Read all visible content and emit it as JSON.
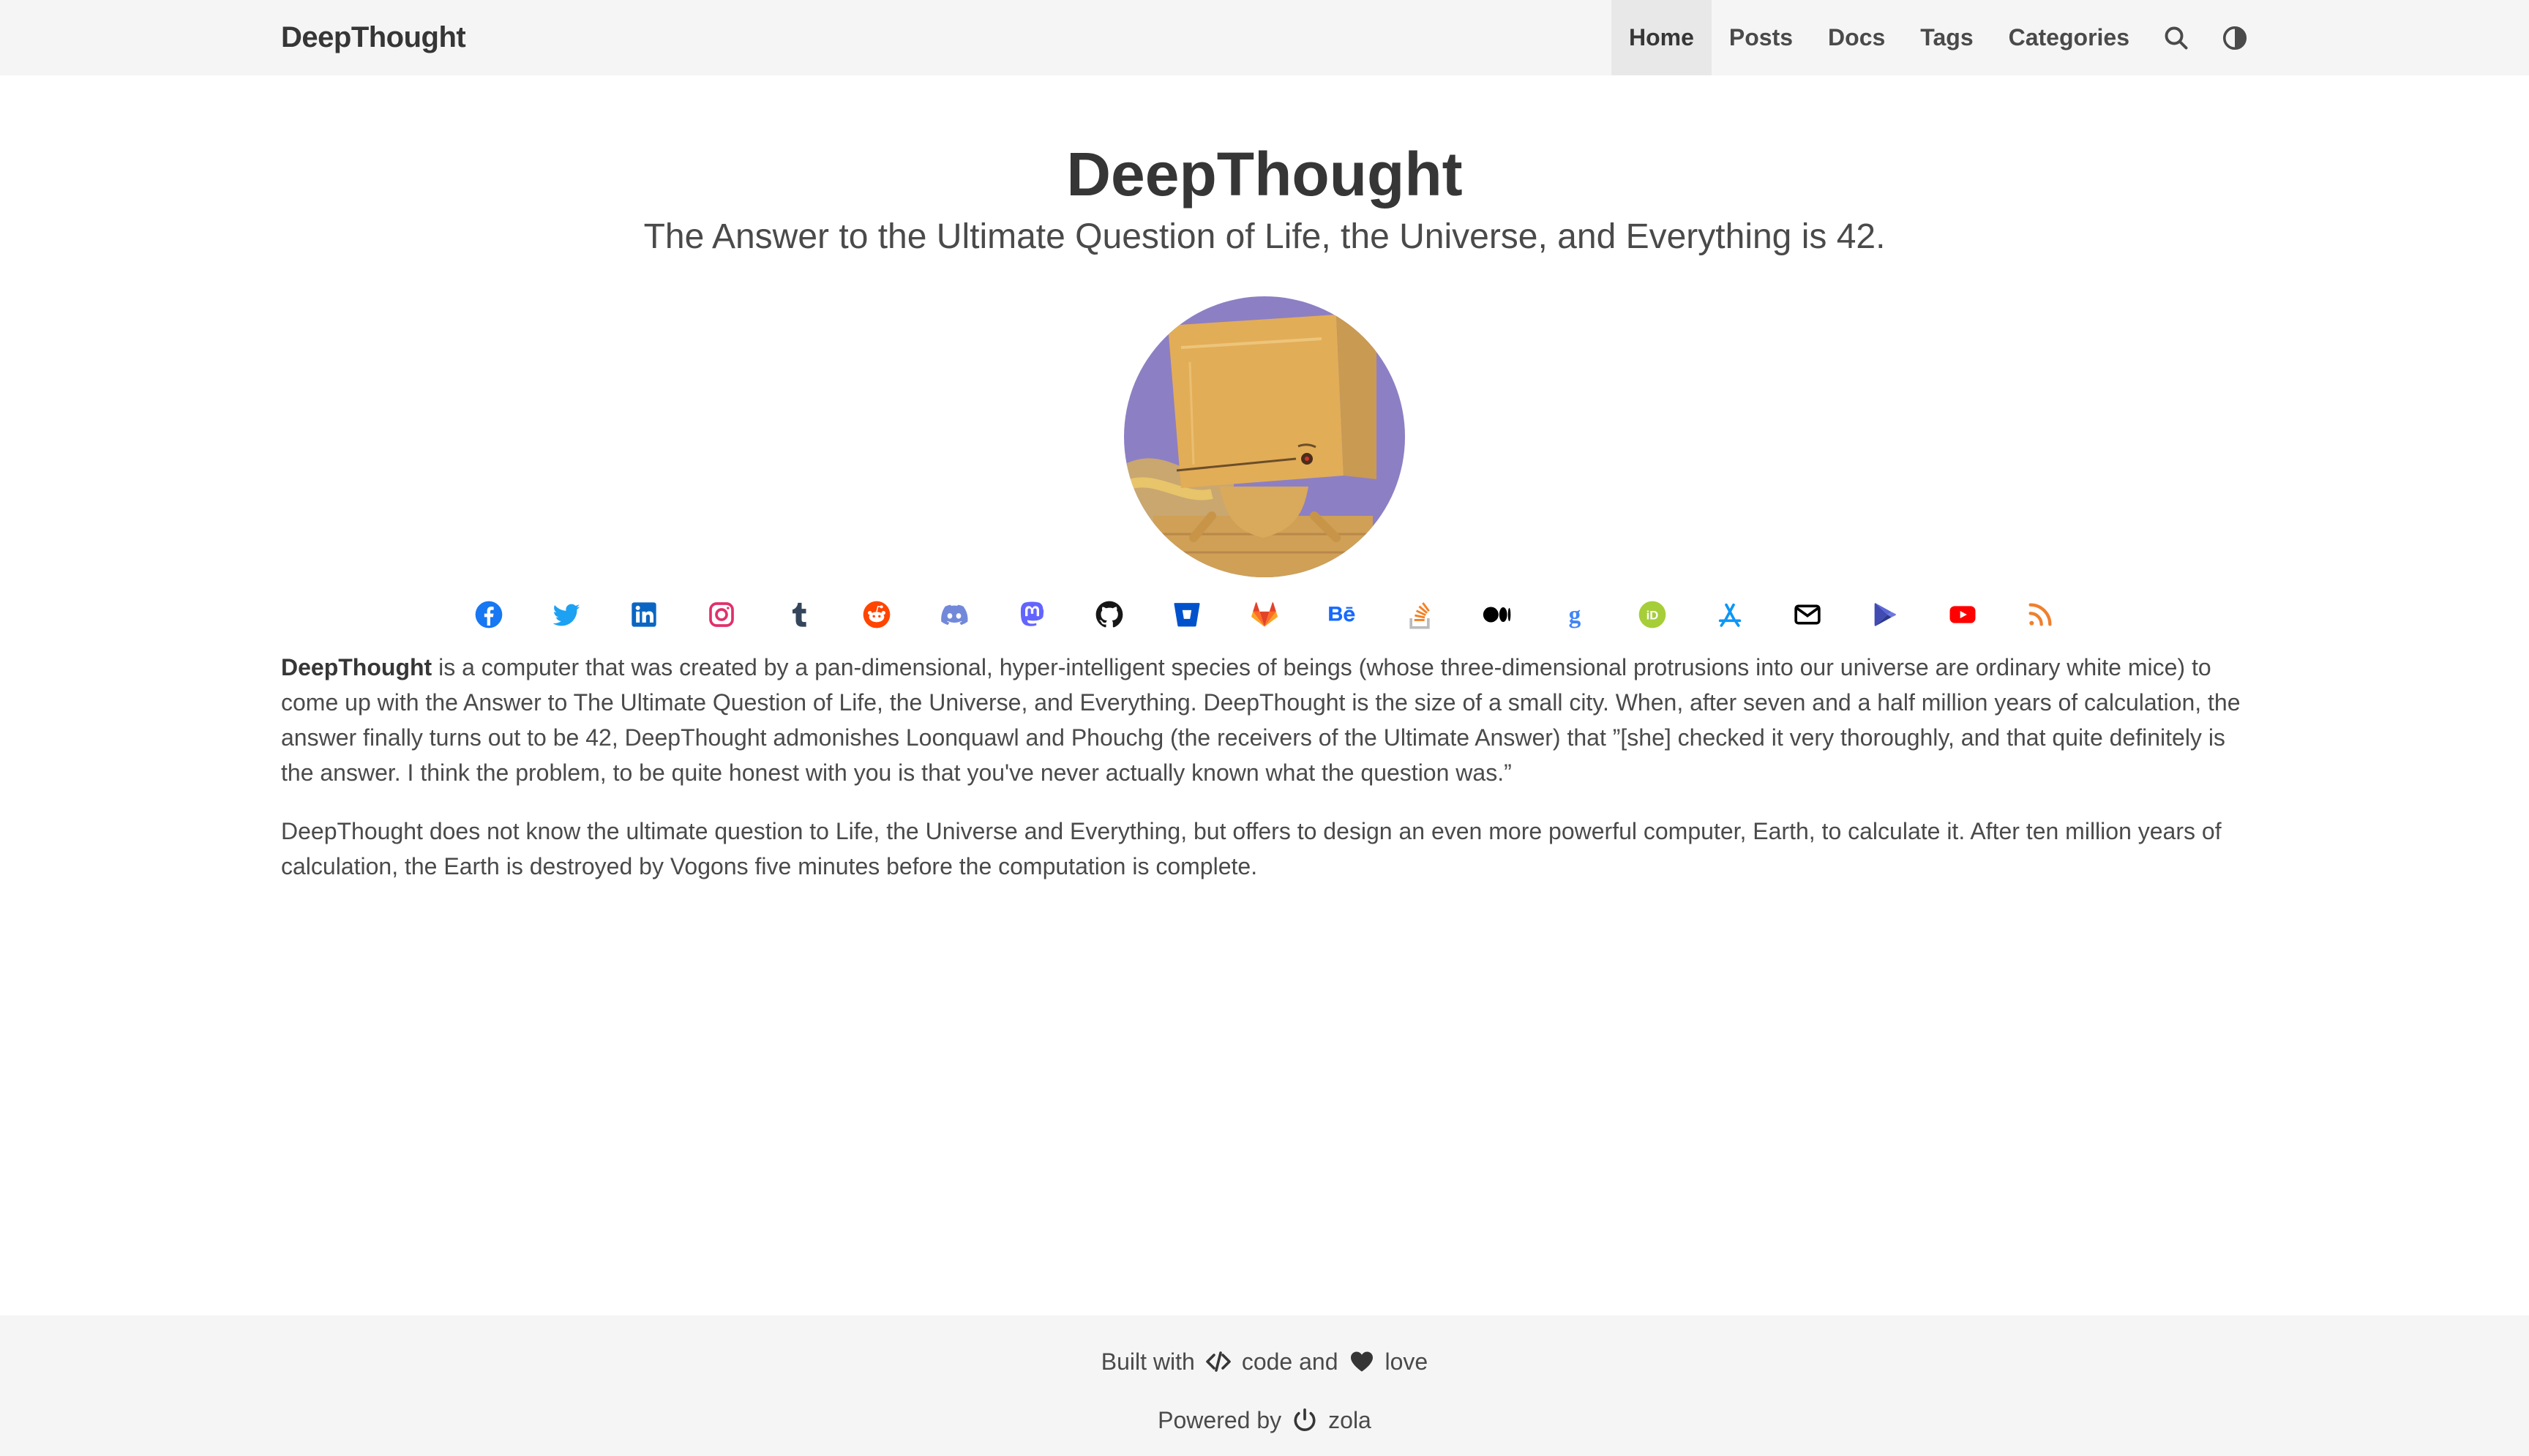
{
  "navbar": {
    "brand": "DeepThought",
    "items": [
      {
        "label": "Home",
        "active": true
      },
      {
        "label": "Posts",
        "active": false
      },
      {
        "label": "Docs",
        "active": false
      },
      {
        "label": "Tags",
        "active": false
      },
      {
        "label": "Categories",
        "active": false
      }
    ],
    "icons": [
      "search-icon",
      "theme-toggle-icon"
    ]
  },
  "hero": {
    "title": "DeepThought",
    "subtitle": "The Answer to the Ultimate Question of Life, the Universe, and Everything is 42."
  },
  "social_icons": [
    {
      "name": "facebook-icon",
      "color": "#1877f2"
    },
    {
      "name": "twitter-icon",
      "color": "#1da1f2"
    },
    {
      "name": "linkedin-icon",
      "color": "#0a66c2"
    },
    {
      "name": "instagram-icon",
      "color": "#e1306c"
    },
    {
      "name": "tumblr-icon",
      "color": "#35465c"
    },
    {
      "name": "reddit-icon",
      "color": "#ff4500"
    },
    {
      "name": "discord-icon",
      "color": "#7289da"
    },
    {
      "name": "mastodon-icon",
      "color": "#6364ff"
    },
    {
      "name": "github-icon",
      "color": "#181717"
    },
    {
      "name": "bitbucket-icon",
      "color": "#0052cc"
    },
    {
      "name": "gitlab-icon",
      "color": "#e24329"
    },
    {
      "name": "behance-icon",
      "color": "#1769ff"
    },
    {
      "name": "stackoverflow-icon",
      "color": "#f48024"
    },
    {
      "name": "medium-icon",
      "color": "#000000"
    },
    {
      "name": "google-scholar-icon",
      "color": "#4285f4"
    },
    {
      "name": "orcid-icon",
      "color": "#a6ce39"
    },
    {
      "name": "app-store-icon",
      "color": "#0d96f6"
    },
    {
      "name": "email-icon",
      "color": "#000000"
    },
    {
      "name": "google-play-icon",
      "color": "#414bb2"
    },
    {
      "name": "youtube-icon",
      "color": "#ff0000"
    },
    {
      "name": "rss-icon",
      "color": "#ee802f"
    }
  ],
  "content": {
    "p1_bold": "DeepThought",
    "p1_rest": " is a computer that was created by a pan-dimensional, hyper-intelligent species of beings (whose three-dimensional protrusions into our universe are ordinary white mice) to come up with the Answer to The Ultimate Question of Life, the Universe, and Everything. DeepThought is the size of a small city. When, after seven and a half million years of calculation, the answer finally turns out to be 42, DeepThought admonishes Loonquawl and Phouchg (the receivers of the Ultimate Answer) that ”[she] checked it very thoroughly, and that quite definitely is the answer. I think the problem, to be quite honest with you is that you've never actually known what the question was.”",
    "p2": "DeepThought does not know the ultimate question to Life, the Universe and Everything, but offers to design an even more powerful computer, Earth, to calculate it. After ten million years of calculation, the Earth is destroyed by Vogons five minutes before the computation is complete."
  },
  "footer": {
    "built_with": "Built with",
    "code": "code and",
    "love": "love",
    "powered_by": "Powered by",
    "zola": "zola"
  }
}
